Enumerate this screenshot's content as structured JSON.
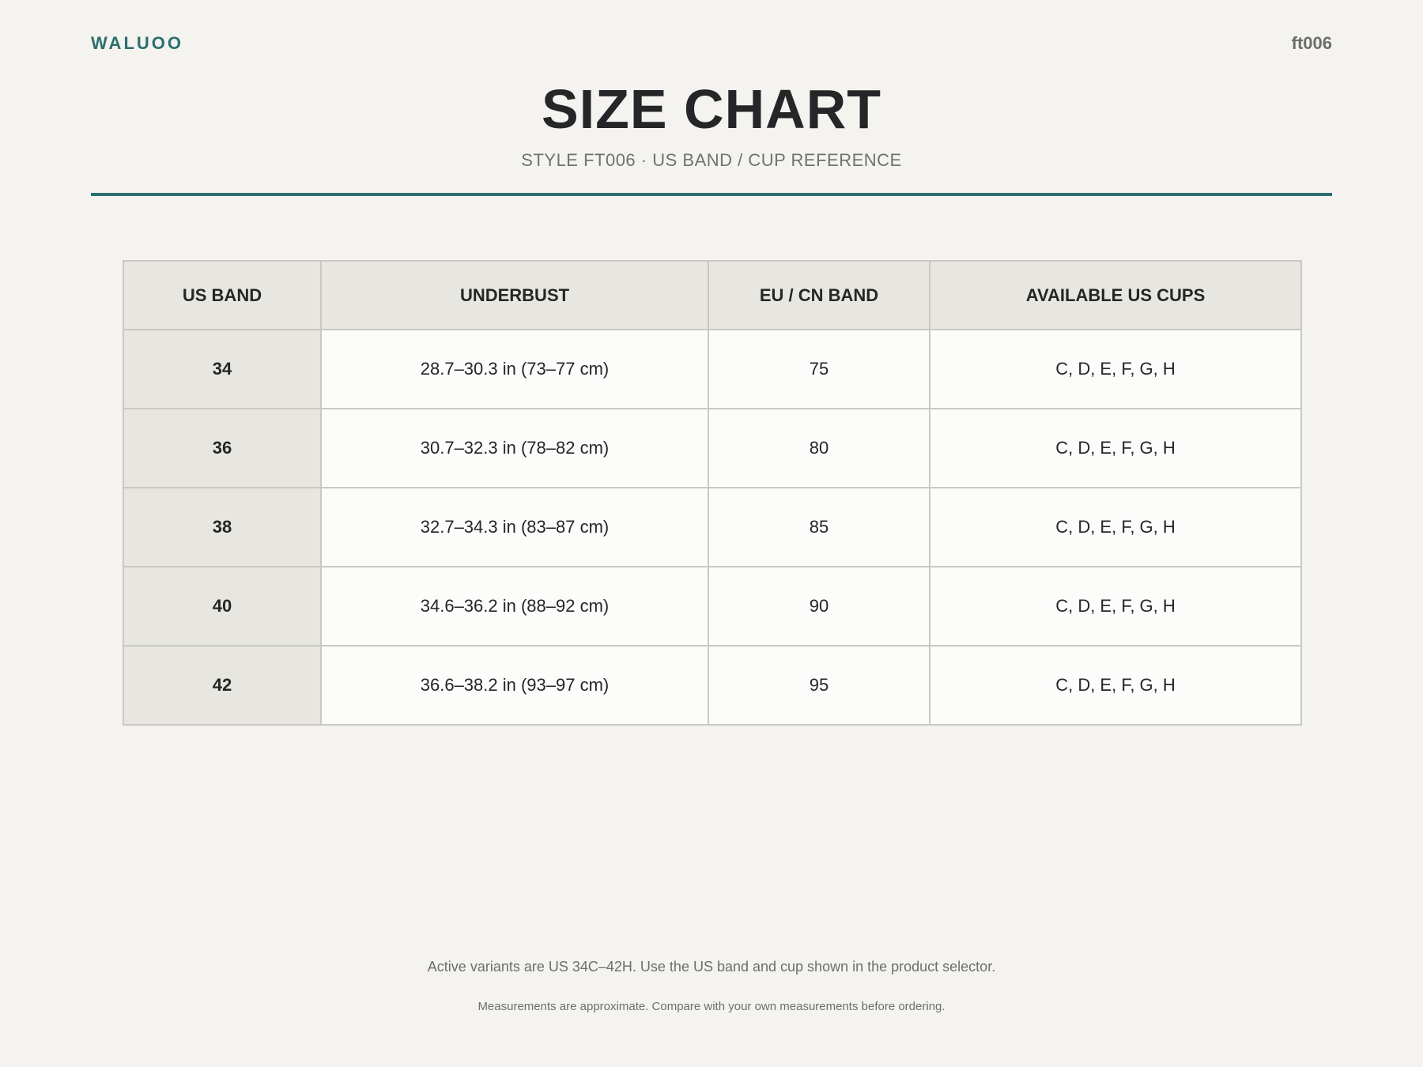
{
  "header": {
    "brand": "WALUOO",
    "code": "ft006",
    "title": "SIZE CHART",
    "subtitle": "STYLE FT006 · US BAND / CUP REFERENCE"
  },
  "table": {
    "columns": [
      "US BAND",
      "UNDERBUST",
      "EU / CN BAND",
      "AVAILABLE US CUPS"
    ],
    "rows": [
      {
        "band": "34",
        "underbust": "28.7–30.3 in (73–77 cm)",
        "eu": "75",
        "cups": "C, D, E, F, G, H"
      },
      {
        "band": "36",
        "underbust": "30.7–32.3 in (78–82 cm)",
        "eu": "80",
        "cups": "C, D, E, F, G, H"
      },
      {
        "band": "38",
        "underbust": "32.7–34.3 in (83–87 cm)",
        "eu": "85",
        "cups": "C, D, E, F, G, H"
      },
      {
        "band": "40",
        "underbust": "34.6–36.2 in (88–92 cm)",
        "eu": "90",
        "cups": "C, D, E, F, G, H"
      },
      {
        "band": "42",
        "underbust": "36.6–38.2 in (93–97 cm)",
        "eu": "95",
        "cups": "C, D, E, F, G, H"
      }
    ]
  },
  "footer": {
    "note_primary": "Active variants are US 34C–42H. Use the US band and cup shown in the product selector.",
    "note_secondary": "Measurements are approximate. Compare with your own measurements before ordering."
  },
  "colors": {
    "accent": "#2b6f70",
    "background": "#f4f3ef",
    "header_cell": "#e8e6e0",
    "body_cell": "#fcfcfa"
  }
}
